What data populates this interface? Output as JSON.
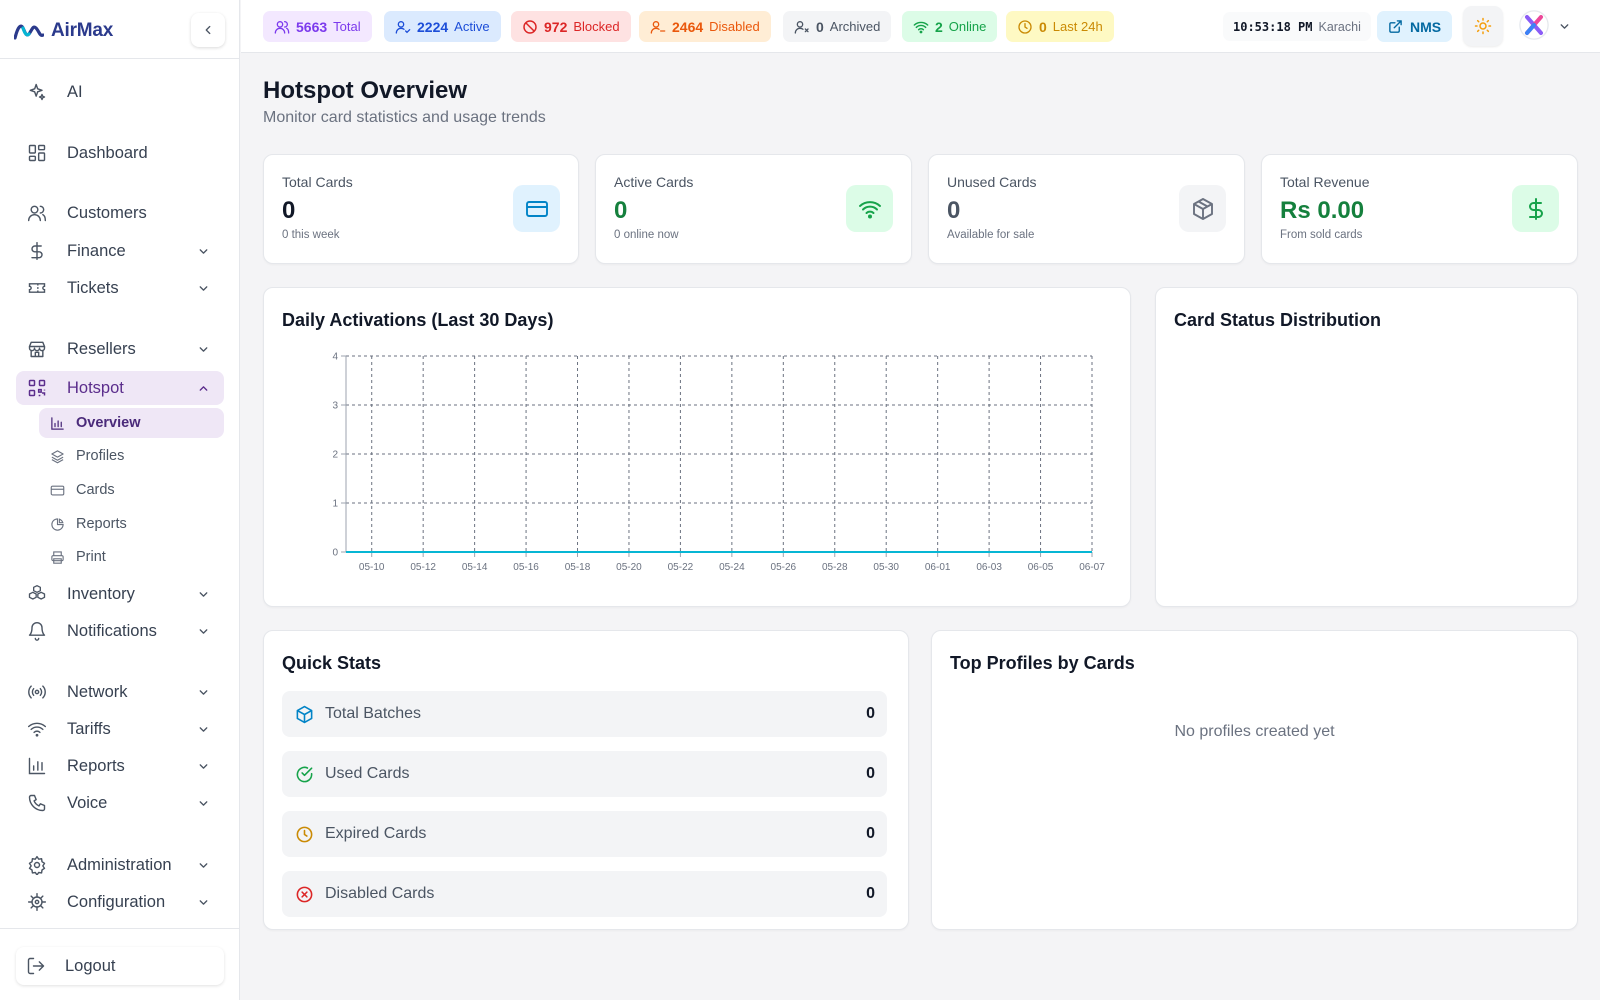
{
  "app": {
    "name": "AirMax",
    "brand_color": "#2b3a8c",
    "accent_color": "#5b2d8c"
  },
  "sidebar": {
    "collapse_icon": "chevron-left-icon",
    "items": [
      {
        "label": "AI",
        "icon": "sparkles-icon"
      },
      {
        "label": "Dashboard",
        "icon": "grid-icon"
      },
      {
        "label": "Customers",
        "icon": "users-icon",
        "expandable": false
      },
      {
        "label": "Finance",
        "icon": "dollar-icon",
        "expandable": true
      },
      {
        "label": "Tickets",
        "icon": "ticket-icon",
        "expandable": true
      },
      {
        "label": "Resellers",
        "icon": "store-icon",
        "expandable": true
      },
      {
        "label": "Hotspot",
        "icon": "qr-icon",
        "expandable": true,
        "expanded": true,
        "active": true
      },
      {
        "label": "Inventory",
        "icon": "boxes-icon",
        "expandable": true
      },
      {
        "label": "Notifications",
        "icon": "bell-icon",
        "expandable": true
      },
      {
        "label": "Network",
        "icon": "radio-icon",
        "expandable": true
      },
      {
        "label": "Tariffs",
        "icon": "wifi-icon",
        "expandable": true
      },
      {
        "label": "Reports",
        "icon": "bar-chart-icon",
        "expandable": true
      },
      {
        "label": "Voice",
        "icon": "phone-icon",
        "expandable": true
      },
      {
        "label": "Administration",
        "icon": "gear-icon",
        "expandable": true
      },
      {
        "label": "Configuration",
        "icon": "cog-icon",
        "expandable": true
      }
    ],
    "subitems": [
      {
        "label": "Overview",
        "icon": "chart-icon",
        "active": true
      },
      {
        "label": "Profiles",
        "icon": "layers-icon"
      },
      {
        "label": "Cards",
        "icon": "card-icon"
      },
      {
        "label": "Reports",
        "icon": "pie-icon"
      },
      {
        "label": "Print",
        "icon": "printer-icon"
      }
    ],
    "logout": "Logout"
  },
  "topbar": {
    "pills": [
      {
        "value": "5663",
        "label": "Total",
        "color": "#7c3aed",
        "bg": "#f3e8ff"
      },
      {
        "value": "2224",
        "label": "Active",
        "color": "#1d4ed8",
        "bg": "#dbeafe"
      },
      {
        "value": "972",
        "label": "Blocked",
        "color": "#dc2626",
        "bg": "#fee2e2"
      },
      {
        "value": "2464",
        "label": "Disabled",
        "color": "#ea580c",
        "bg": "#ffedd5"
      },
      {
        "value": "0",
        "label": "Archived",
        "color": "#4b5563",
        "bg": "#f3f4f6"
      },
      {
        "value": "2",
        "label": "Online",
        "color": "#16a34a",
        "bg": "#dcfce7"
      },
      {
        "value": "0",
        "label": "Last 24h",
        "color": "#ca8a04",
        "bg": "#fef9c3"
      }
    ],
    "clock": {
      "time": "10:53:18 PM",
      "zone": "Karachi"
    },
    "nms_label": "NMS"
  },
  "page": {
    "title": "Hotspot Overview",
    "subtitle": "Monitor card statistics and usage trends"
  },
  "stats": [
    {
      "label": "Total Cards",
      "value": "0",
      "sub": "0 this week",
      "icon": "credit-card-icon",
      "color": "#0284c7",
      "bg": "#e0f2fe",
      "value_color": "#111827"
    },
    {
      "label": "Active Cards",
      "value": "0",
      "sub": "0 online now",
      "icon": "wifi-icon",
      "color": "#16a34a",
      "bg": "#dcfce7",
      "value_color": "#15803d"
    },
    {
      "label": "Unused Cards",
      "value": "0",
      "sub": "Available for sale",
      "icon": "package-icon",
      "color": "#6b7280",
      "bg": "#f3f4f6",
      "value_color": "#4b5563"
    },
    {
      "label": "Total Revenue",
      "value": "Rs 0.00",
      "sub": "From sold cards",
      "icon": "dollar-icon",
      "color": "#16a34a",
      "bg": "#dcfce7",
      "value_color": "#15803d"
    }
  ],
  "daily_chart_title": "Daily Activations (Last 30 Days)",
  "status_chart_title": "Card Status Distribution",
  "chart_data": {
    "type": "line",
    "title": "Daily Activations (Last 30 Days)",
    "xlabel": "",
    "ylabel": "",
    "x": [
      "05-09",
      "05-10",
      "05-11",
      "05-12",
      "05-13",
      "05-14",
      "05-15",
      "05-16",
      "05-17",
      "05-18",
      "05-19",
      "05-20",
      "05-21",
      "05-22",
      "05-23",
      "05-24",
      "05-25",
      "05-26",
      "05-27",
      "05-28",
      "05-29",
      "05-30",
      "05-31",
      "06-01",
      "06-02",
      "06-03",
      "06-04",
      "06-05",
      "06-06",
      "06-07"
    ],
    "x_ticks": [
      "05-10",
      "05-12",
      "05-14",
      "05-16",
      "05-18",
      "05-20",
      "05-22",
      "05-24",
      "05-26",
      "05-28",
      "05-30",
      "06-01",
      "06-03",
      "06-05",
      "06-07"
    ],
    "series": [
      {
        "values": [
          0,
          0,
          0,
          0,
          0,
          0,
          0,
          0,
          0,
          0,
          0,
          0,
          0,
          0,
          0,
          0,
          0,
          0,
          0,
          0,
          0,
          0,
          0,
          0,
          0,
          0,
          0,
          0,
          0,
          0
        ],
        "color": "#06b6d4"
      }
    ],
    "ylim": [
      0,
      4
    ],
    "y_ticks": [
      0,
      1,
      2,
      3,
      4
    ],
    "grid": true,
    "grid_style": "dashed"
  },
  "quick_stats": {
    "title": "Quick Stats",
    "rows": [
      {
        "label": "Total Batches",
        "value": "0",
        "icon": "package-icon",
        "color": "#0284c7"
      },
      {
        "label": "Used Cards",
        "value": "0",
        "icon": "check-circle-icon",
        "color": "#16a34a"
      },
      {
        "label": "Expired Cards",
        "value": "0",
        "icon": "clock-icon",
        "color": "#ca8a04"
      },
      {
        "label": "Disabled Cards",
        "value": "0",
        "icon": "x-circle-icon",
        "color": "#dc2626"
      }
    ]
  },
  "top_profiles": {
    "title": "Top Profiles by Cards",
    "empty": "No profiles created yet"
  }
}
